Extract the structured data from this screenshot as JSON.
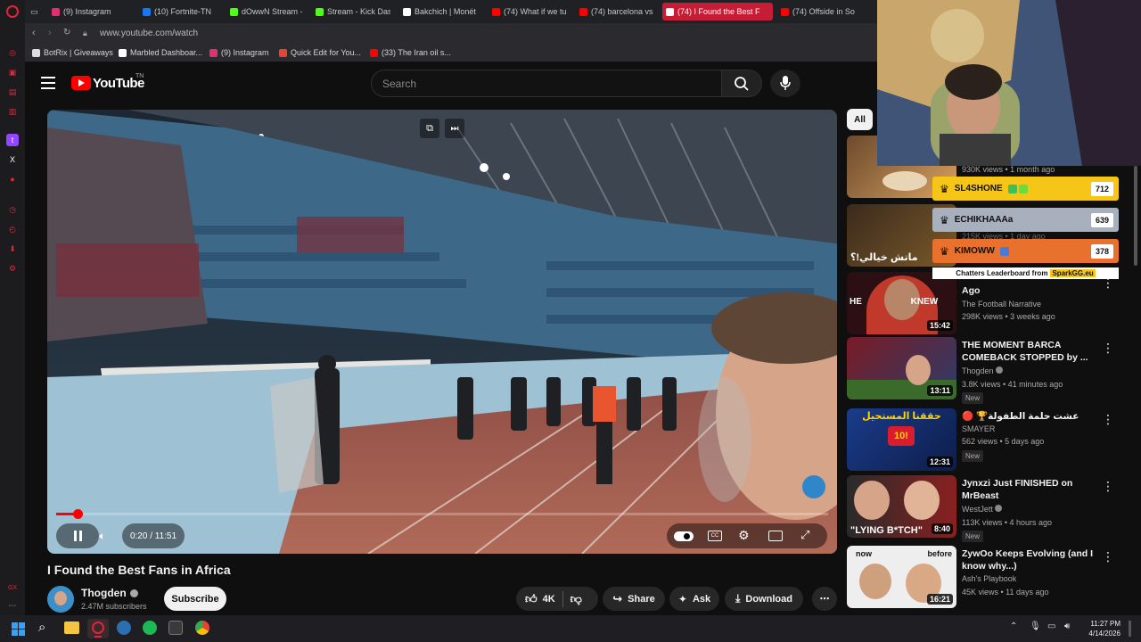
{
  "tabs": [
    {
      "label": "(9) Instagram",
      "color": "#e1306c"
    },
    {
      "label": "(10) Fortnite-TN",
      "color": "#1877f2"
    },
    {
      "label": "dOwwN Stream -",
      "color": "#53fc18"
    },
    {
      "label": "Stream - Kick Das",
      "color": "#53fc18"
    },
    {
      "label": "Bakchich | Monét",
      "color": "#ffffff"
    },
    {
      "label": "(74) What if we tu",
      "color": "#ff0000"
    },
    {
      "label": "(74) barcelona vs",
      "color": "#ff0000"
    },
    {
      "label": "(74) I Found the Best F",
      "color": "#ff0000"
    },
    {
      "label": "(74) Offside in So",
      "color": "#ff0000"
    }
  ],
  "address": {
    "url": "www.youtube.com/watch"
  },
  "bookmarks": [
    {
      "label": "BotRix | Giveaways",
      "icon": "botrix-icon"
    },
    {
      "label": "Marbled Dashboar...",
      "icon": "grid-icon"
    },
    {
      "label": "(9) Instagram",
      "icon": "instagram-icon"
    },
    {
      "label": "Quick Edit for You...",
      "icon": "gmail-icon"
    },
    {
      "label": "(33) The Iran oil s...",
      "icon": "youtube-icon"
    }
  ],
  "header": {
    "logo": "YouTube",
    "country": "TN",
    "search_placeholder": "Search"
  },
  "player": {
    "time": "0:20 / 11:51",
    "progress": 0.028
  },
  "video": {
    "title": "I Found the Best Fans in Africa",
    "channel": "Thogden",
    "subscribers": "2.47M subscribers",
    "subscribe_label": "Subscribe",
    "likes": "4K",
    "share_label": "Share",
    "ask_label": "Ask",
    "download_label": "Download"
  },
  "filter": {
    "all_label": "All"
  },
  "leaderboard": {
    "rows": [
      {
        "name": "SL4SHONE",
        "score": "712",
        "bg": "#f5c518"
      },
      {
        "name": "ECHIKHAAAa",
        "score": "639",
        "bg": "#a8b0bd"
      },
      {
        "name": "KIMOWW",
        "score": "378",
        "bg": "#e8712d"
      }
    ],
    "footer": "Chatters Leaderboard from",
    "brand": "SparkGG.eu"
  },
  "recommendations": [
    {
      "title": "",
      "channel": "",
      "meta": "930K views • 1 month ago",
      "duration": "",
      "new": ""
    },
    {
      "title": "",
      "channel": "",
      "meta": "215K views • 1 day ago",
      "duration": "",
      "new": "",
      "thumb_text": "ماتش خيالي!؟"
    },
    {
      "title": "Ago",
      "channel": "The Football Narrative",
      "meta": "298K views • 3 weeks ago",
      "duration": "15:42",
      "new": "",
      "thumb_text": "HE KNEW"
    },
    {
      "title": "THE MOMENT BARCA COMEBACK STOPPED by ...",
      "channel": "Thogden",
      "meta": "3.8K views • 41 minutes ago",
      "duration": "13:11",
      "new": "New"
    },
    {
      "title": "🔴 🏆عشت حلمة الطفولة",
      "channel": "SMAYER",
      "meta": "562 views • 5 days ago",
      "duration": "12:31",
      "new": "New",
      "thumb_text": "حققنا المستحيل"
    },
    {
      "title": "Jynxzi Just FINISHED on MrBeast",
      "channel": "WestJett",
      "meta": "113K views • 4 hours ago",
      "duration": "8:40",
      "new": "New",
      "thumb_text": "\"LYING B*TCH\""
    },
    {
      "title": "ZywOo Keeps Evolving (and I know why...)",
      "channel": "Ash's Playbook",
      "meta": "45K views • 11 days ago",
      "duration": "16:21",
      "new": "",
      "thumb_text": "now before"
    }
  ],
  "taskbar": {
    "time": "11:27 PM",
    "date": "4/14/2026"
  }
}
